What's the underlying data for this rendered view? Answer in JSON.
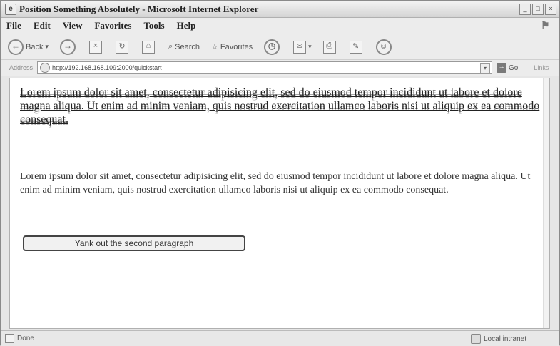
{
  "window": {
    "title": "Position Something Absolutely - Microsoft Internet Explorer",
    "controls": [
      "_",
      "□",
      "×"
    ]
  },
  "menu": [
    "File",
    "Edit",
    "View",
    "Favorites",
    "Tools",
    "Help"
  ],
  "toolbar": {
    "back": "Back",
    "search": "Search",
    "favorites": "Favorites"
  },
  "address": {
    "label": "Address",
    "url": "http://192.168.168.109:2000/quickstart",
    "go": "Go",
    "links": "Links"
  },
  "content": {
    "paragraph1": "Lorem ipsum dolor sit amet, consectetur adipisicing elit, sed do eiusmod tempor incididunt ut labore et dolore magna aliqua. Ut enim ad minim veniam, quis nostrud exercitation ullamco laboris nisi ut aliquip ex ea commodo consequat.",
    "paragraph2": "Lorem ipsum dolor sit amet, consectetur adipisicing elit, sed do eiusmod tempor incididunt ut labore et dolore magna aliqua. Ut enim ad minim veniam, quis nostrud exercitation ullamco laboris nisi ut aliquip ex ea commodo consequat.",
    "button_label": "Yank out the second paragraph"
  },
  "status": {
    "text": "Done",
    "zone": "Local intranet"
  }
}
